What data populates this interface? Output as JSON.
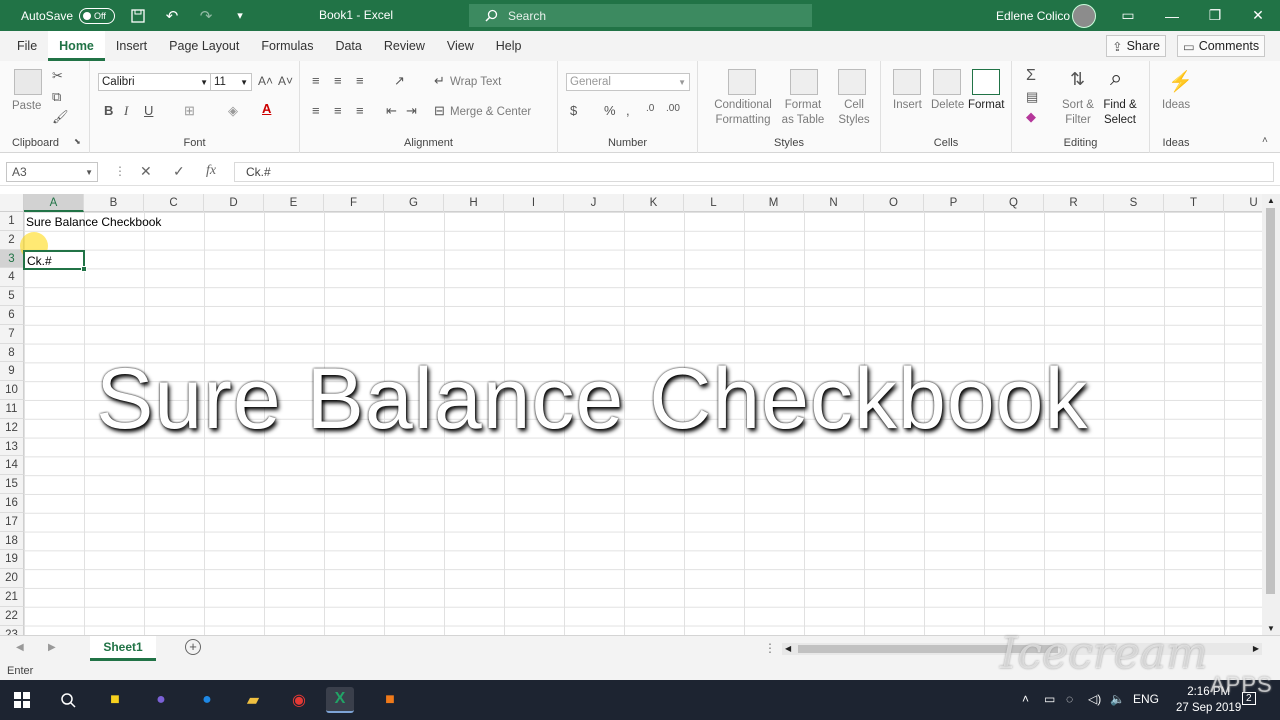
{
  "titlebar": {
    "autosave_label": "AutoSave",
    "autosave_state": "Off",
    "doc_title": "Book1 - Excel",
    "search_placeholder": "Search",
    "user_name": "Edlene Colico"
  },
  "menu": {
    "items": [
      "File",
      "Home",
      "Insert",
      "Page Layout",
      "Formulas",
      "Data",
      "Review",
      "View",
      "Help"
    ],
    "active": "Home",
    "share": "Share",
    "comments": "Comments"
  },
  "ribbon": {
    "clipboard": {
      "label": "Clipboard",
      "paste": "Paste"
    },
    "font": {
      "label": "Font",
      "family": "Calibri",
      "size": "11",
      "bold": "B",
      "italic": "I",
      "underline": "U"
    },
    "alignment": {
      "label": "Alignment",
      "wrap_text": "Wrap Text",
      "merge_center": "Merge & Center"
    },
    "number": {
      "label": "Number",
      "format": "General"
    },
    "styles": {
      "label": "Styles",
      "conditional": "Conditional Formatting",
      "format_as_table": "Format as Table",
      "cell_styles": "Cell Styles"
    },
    "cells": {
      "label": "Cells",
      "insert": "Insert",
      "delete": "Delete",
      "format": "Format"
    },
    "editing": {
      "label": "Editing",
      "sort_filter": "Sort & Filter",
      "find_select": "Find & Select"
    },
    "ideas": {
      "label": "Ideas",
      "ideas": "Ideas"
    }
  },
  "formula_bar": {
    "name_box": "A3",
    "formula": "Ck.#"
  },
  "grid": {
    "columns": [
      "A",
      "B",
      "C",
      "D",
      "E",
      "F",
      "G",
      "H",
      "I",
      "J",
      "K",
      "L",
      "M",
      "N",
      "O",
      "P",
      "Q",
      "R",
      "S",
      "T",
      "U"
    ],
    "rows": [
      "1",
      "2",
      "3",
      "4",
      "5",
      "6",
      "7",
      "8",
      "9",
      "10",
      "11",
      "12",
      "13",
      "14",
      "15",
      "16",
      "17",
      "18",
      "19",
      "20",
      "21",
      "22",
      "23"
    ],
    "selected_column": "A",
    "selected_row": "3",
    "cell_a1": "Sure Balance Checkbook",
    "cell_a3": "Ck.#"
  },
  "overlay": {
    "title": "Sure Balance Checkbook"
  },
  "sheets": {
    "tabs": [
      "Sheet1"
    ],
    "active": "Sheet1"
  },
  "status": {
    "mode": "Enter"
  },
  "taskbar": {
    "time": "2:16 PM",
    "date": "27 Sep 2019",
    "language": "ENG",
    "notifications": "2"
  },
  "watermark": {
    "brand": "Icecream",
    "sub": "APPS"
  },
  "colors": {
    "excel_green": "#217346",
    "taskbar": "#1d2431"
  }
}
